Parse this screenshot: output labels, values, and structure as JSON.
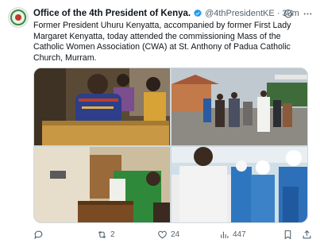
{
  "tweet": {
    "author_name": "Office of the 4th President of Kenya.",
    "handle": "@4thPresidentKE",
    "separator": "·",
    "time": "30m",
    "text": "Former President Uhuru Kenyatta, accompanied by former First Lady Margaret Kenyatta, today attended the commissioning Mass of the Catholic Women Association (CWA) at St. Anthony of Padua Catholic Church, Murram.",
    "icons": {
      "verified": "verified-badge-icon",
      "grok": "grok-icon",
      "more": "more-icon"
    },
    "media": [
      {
        "name": "photo-kenyatta-praying",
        "description_icon": "image"
      },
      {
        "name": "photo-arrival-church-grounds",
        "description_icon": "image"
      },
      {
        "name": "photo-priest-altar",
        "description_icon": "image"
      },
      {
        "name": "photo-cwa-members",
        "description_icon": "image"
      }
    ]
  },
  "actions": {
    "reply_count": "",
    "retweet_count": "2",
    "like_count": "24",
    "view_count": "447"
  },
  "colors": {
    "accent": "#1d9bf0",
    "muted": "#536471",
    "text": "#0f1419",
    "border": "#cfd9de"
  }
}
